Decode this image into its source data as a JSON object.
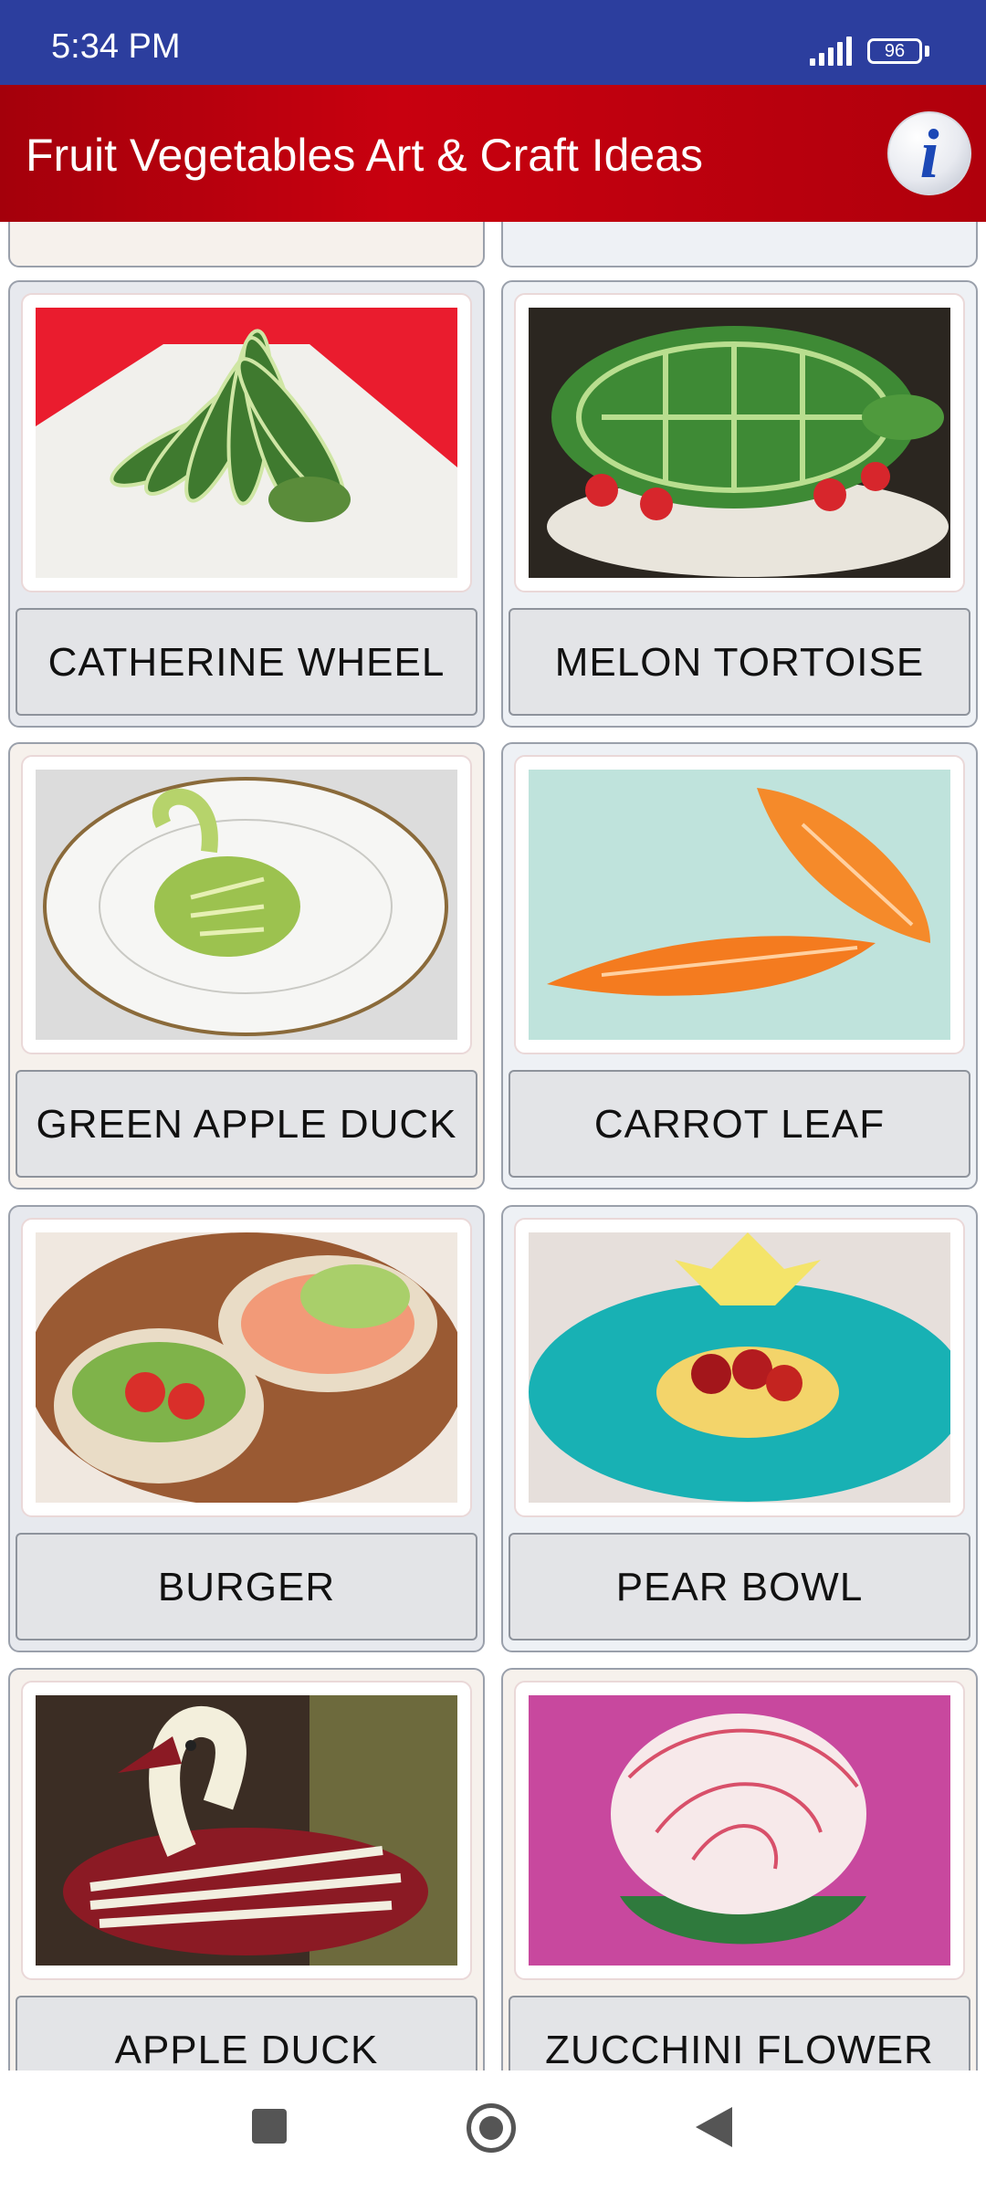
{
  "status_bar": {
    "time": "5:34 PM",
    "battery": "96",
    "signal_icon": "signal-icon"
  },
  "app_bar": {
    "title": "Fruit Vegetables Art & Craft Ideas",
    "info_icon": "info-icon",
    "info_glyph": "i",
    "color": "#b0000c"
  },
  "items": [
    {
      "label": "CATHERINE WHEEL"
    },
    {
      "label": "MELON TORTOISE"
    },
    {
      "label": "GREEN APPLE DUCK"
    },
    {
      "label": "CARROT LEAF"
    },
    {
      "label": "BURGER"
    },
    {
      "label": "PEAR BOWL"
    },
    {
      "label": "APPLE DUCK"
    },
    {
      "label": "ZUCCHINI FLOWER"
    }
  ],
  "nav_bar": {
    "icons": [
      "recents-square-icon",
      "home-circle-icon",
      "back-triangle-icon"
    ]
  }
}
